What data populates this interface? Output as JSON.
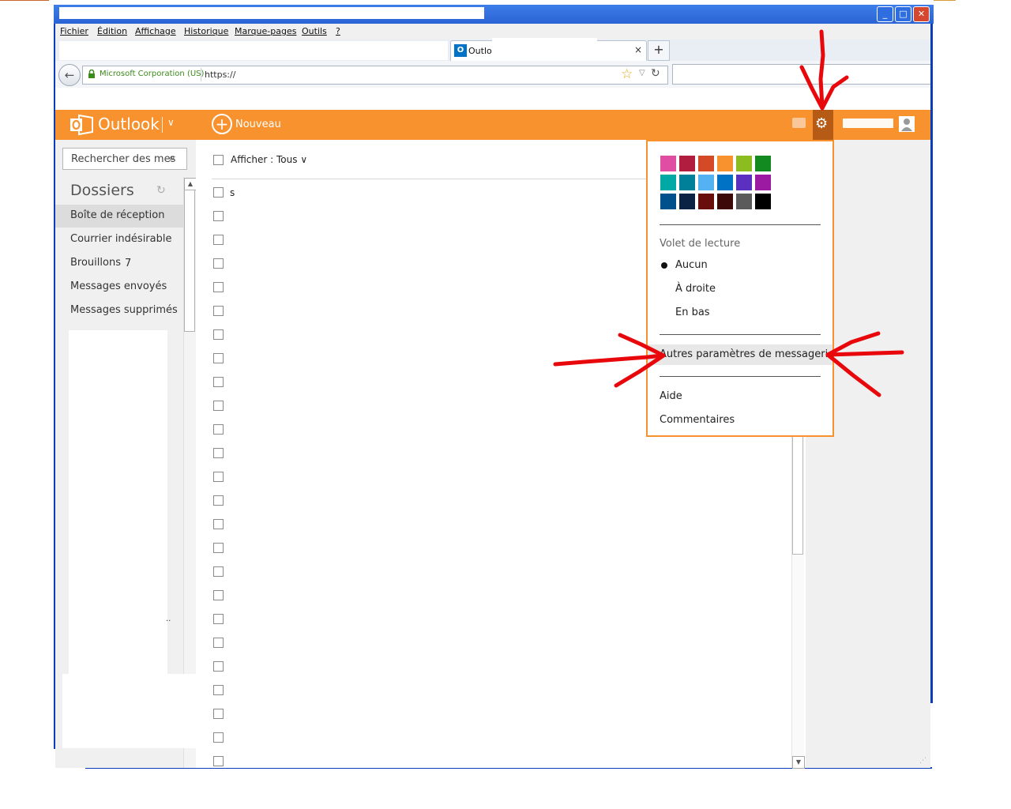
{
  "browser": {
    "menu": [
      "Fichier",
      "Édition",
      "Affichage",
      "Historique",
      "Marque-pages",
      "Outils",
      "?"
    ],
    "tab_label": "Outloc",
    "tab_close": "×",
    "tab_new": "+",
    "identity": "Microsoft Corporation (US)",
    "url": "https://",
    "window_buttons": {
      "minimize": "_",
      "maximize": "□",
      "close": "✕"
    }
  },
  "outlook": {
    "logo": "Outlook",
    "new_label": "Nouveau",
    "colors": {
      "header": "#f7922e",
      "gear_active": "#b65b15"
    }
  },
  "left_pane": {
    "search_placeholder": "Rechercher des mes",
    "folders_title": "Dossiers",
    "folders": [
      {
        "label": "Boîte de réception",
        "selected": true
      },
      {
        "label": "Courrier indésirable"
      },
      {
        "label": "Brouillons",
        "count": "7"
      },
      {
        "label": "Messages envoyés"
      },
      {
        "label": "Messages supprimés"
      }
    ],
    "dots": ".."
  },
  "message_list": {
    "filter_label": "Afficher : Tous",
    "first_row_text": "s",
    "row_count": 25
  },
  "settings_menu": {
    "theme_colors": [
      "#e04ea3",
      "#b01d3f",
      "#d44a26",
      "#f7922e",
      "#8cbd20",
      "#138a1f",
      "#00a9a4",
      "#008199",
      "#55b2f2",
      "#0072c6",
      "#5b2fbf",
      "#9c1aa1",
      "#00508b",
      "#0c2245",
      "#6a0d0d",
      "#3d0808",
      "#5b5b5b",
      "#000000"
    ],
    "reading_pane_title": "Volet de lecture",
    "reading_pane_options": [
      "Aucun",
      "À droite",
      "En bas"
    ],
    "selected_option": "Aucun",
    "other_settings": "Autres paramètres de messagerie",
    "help": "Aide",
    "feedback": "Commentaires"
  }
}
